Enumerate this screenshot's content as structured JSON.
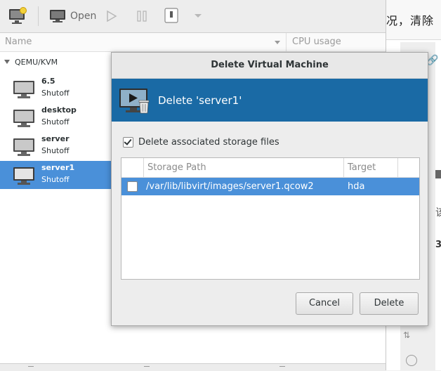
{
  "toolbar": {
    "open_label": "Open"
  },
  "columns": {
    "name": "Name",
    "cpu": "CPU usage"
  },
  "connection": "QEMU/KVM",
  "vms": [
    {
      "name": "6.5",
      "state": "Shutoff"
    },
    {
      "name": "desktop",
      "state": "Shutoff"
    },
    {
      "name": "server",
      "state": "Shutoff"
    },
    {
      "name": "server1",
      "state": "Shutoff",
      "selected": true
    }
  ],
  "editor": {
    "text": "况，清除",
    "side_text_1": "该",
    "side_text_2": "3"
  },
  "dialog": {
    "window_title": "Delete Virtual Machine",
    "banner_title": "Delete 'server1'",
    "delete_storage_label": "Delete associated storage files",
    "delete_storage_checked": true,
    "table_headers": {
      "path": "Storage Path",
      "target": "Target"
    },
    "rows": [
      {
        "checked": false,
        "path": "/var/lib/libvirt/images/server1.qcow2",
        "target": "hda"
      }
    ],
    "cancel_label": "Cancel",
    "delete_label": "Delete"
  },
  "colors": {
    "selection": "#4a90d9",
    "banner": "#1a6aa5"
  }
}
